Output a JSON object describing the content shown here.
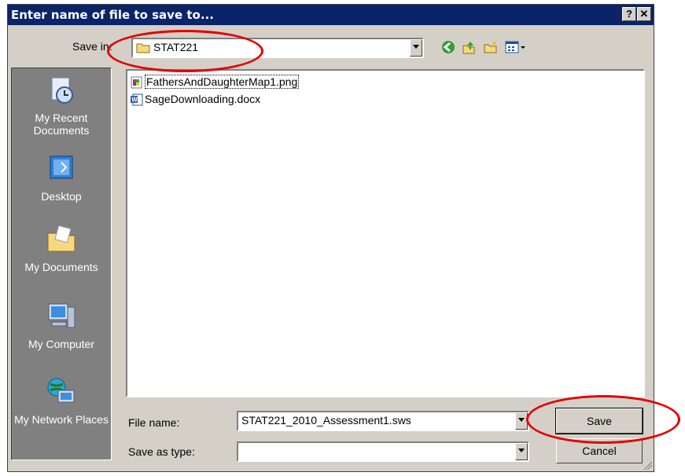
{
  "window": {
    "title": "Enter name of file to save to...",
    "help_glyph": "?",
    "close_glyph": "✕"
  },
  "save_in": {
    "label": "Save in:",
    "value": "STAT221"
  },
  "toolbar": {
    "icons": [
      "back-icon",
      "up-folder-icon",
      "new-folder-icon",
      "views-menu-icon"
    ]
  },
  "places": [
    {
      "label": "My Recent Documents",
      "icon": "recent-documents-icon"
    },
    {
      "label": "Desktop",
      "icon": "desktop-icon"
    },
    {
      "label": "My Documents",
      "icon": "my-documents-icon"
    },
    {
      "label": "My Computer",
      "icon": "my-computer-icon"
    },
    {
      "label": "My Network Places",
      "icon": "network-places-icon"
    }
  ],
  "files": [
    {
      "name": "FathersAndDaughterMap1.png",
      "icon": "png-file-icon",
      "selected": true
    },
    {
      "name": "SageDownloading.docx",
      "icon": "word-file-icon",
      "selected": false
    }
  ],
  "filename": {
    "label": "File name:",
    "value": "STAT221_2010_Assessment1.sws"
  },
  "filetype": {
    "label": "Save as type:",
    "value": ""
  },
  "buttons": {
    "save": "Save",
    "cancel": "Cancel"
  },
  "annotation_color": "#e30000"
}
